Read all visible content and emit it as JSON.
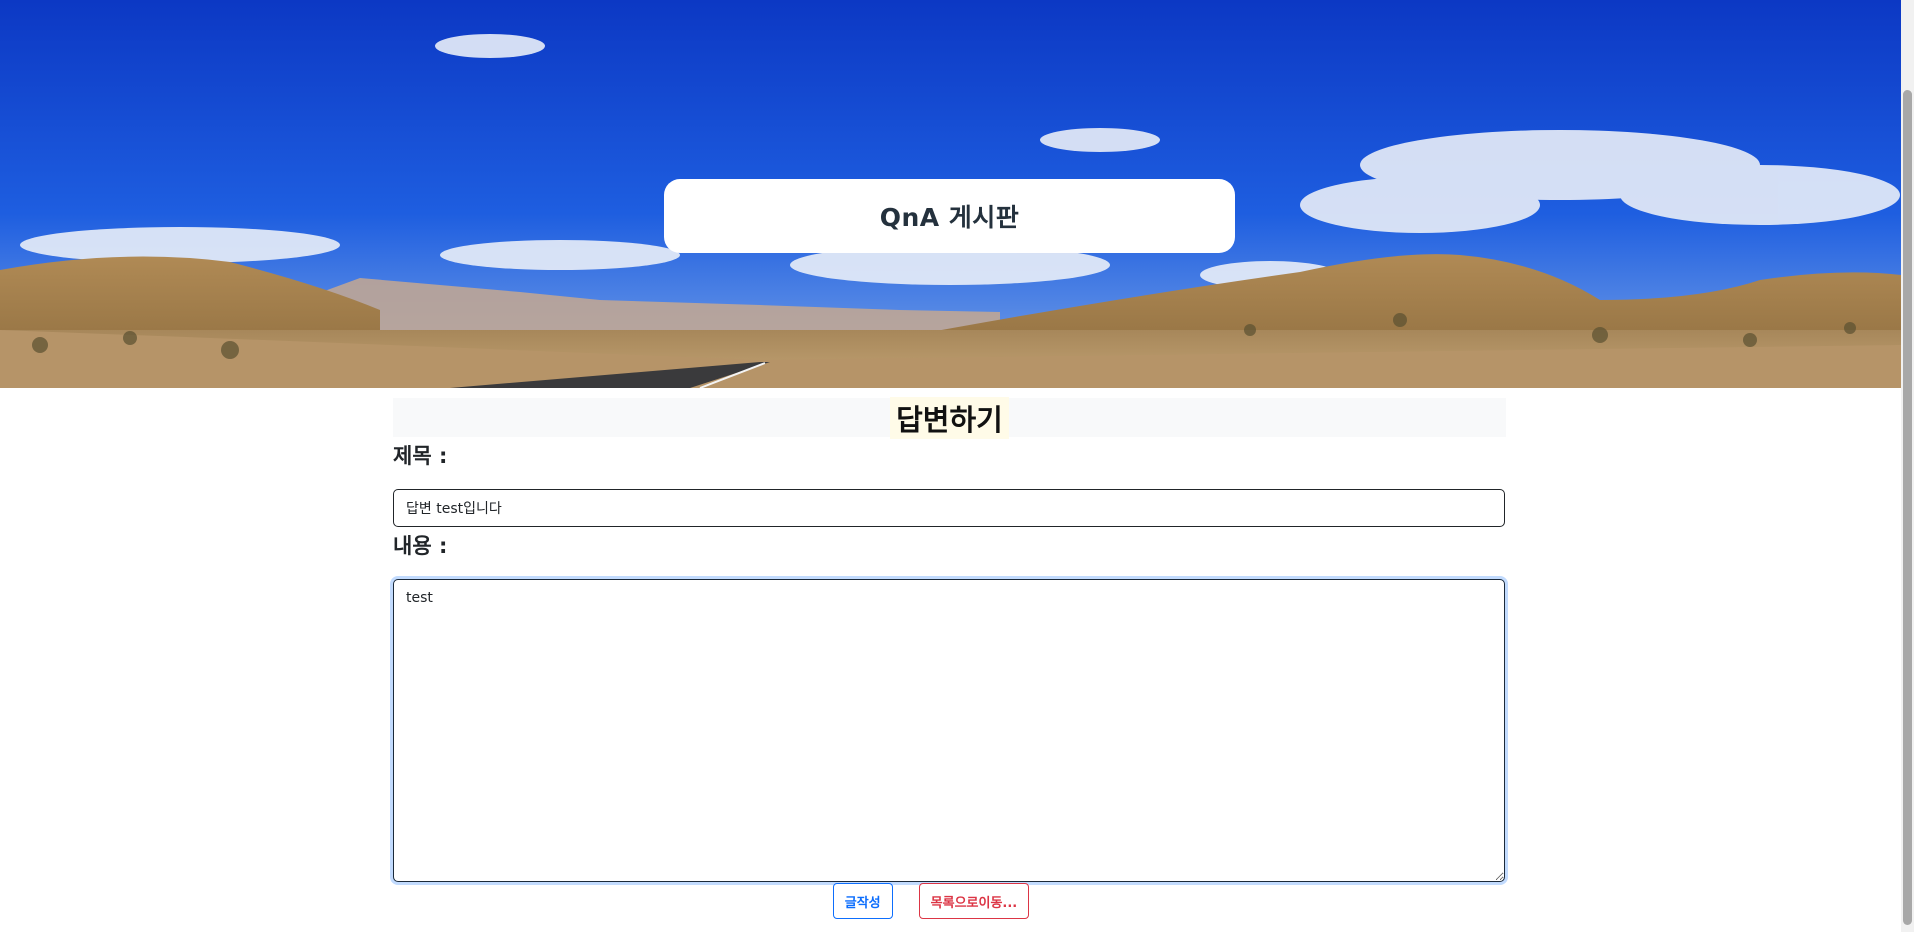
{
  "header": {
    "board_title": "QnA 게시판"
  },
  "form": {
    "heading": "답변하기",
    "title_label": "제목 :",
    "title_value": "답변 test입니다",
    "content_label": "내용 :",
    "content_value": "test"
  },
  "actions": {
    "write_label": "글작성",
    "list_label": "목록으로이동..."
  },
  "colors": {
    "primary": "#0d6efd",
    "danger": "#dc3545",
    "sky": "#1a4fd0"
  }
}
